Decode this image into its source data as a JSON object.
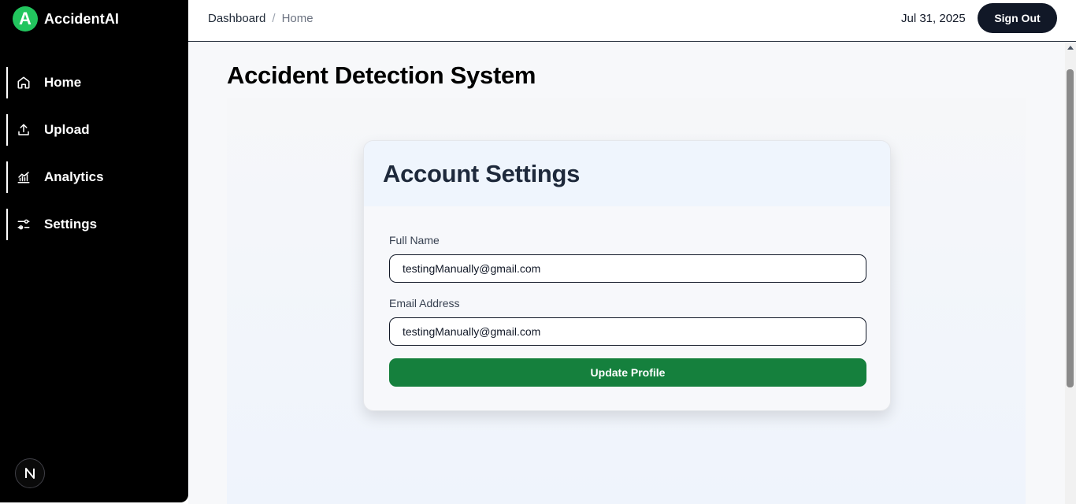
{
  "brand": {
    "logo_letter": "A",
    "name": "AccidentAI",
    "accent": "#22c55e"
  },
  "sidebar": {
    "items": [
      {
        "label": "Home",
        "icon": "home-icon"
      },
      {
        "label": "Upload",
        "icon": "upload-icon"
      },
      {
        "label": "Analytics",
        "icon": "analytics-icon"
      },
      {
        "label": "Settings",
        "icon": "settings-sliders-icon"
      }
    ],
    "avatar_letter": "N"
  },
  "header": {
    "breadcrumb": [
      "Dashboard",
      "Home"
    ],
    "separator": "/",
    "date": "Jul 31, 2025",
    "sign_out_label": "Sign Out"
  },
  "main": {
    "title": "Accident Detection System",
    "card": {
      "title": "Account Settings",
      "full_name_label": "Full Name",
      "full_name_value": "testingManually@gmail.com",
      "email_label": "Email Address",
      "email_value": "testingManually@gmail.com",
      "update_label": "Update Profile",
      "button_color": "#15803d"
    }
  }
}
